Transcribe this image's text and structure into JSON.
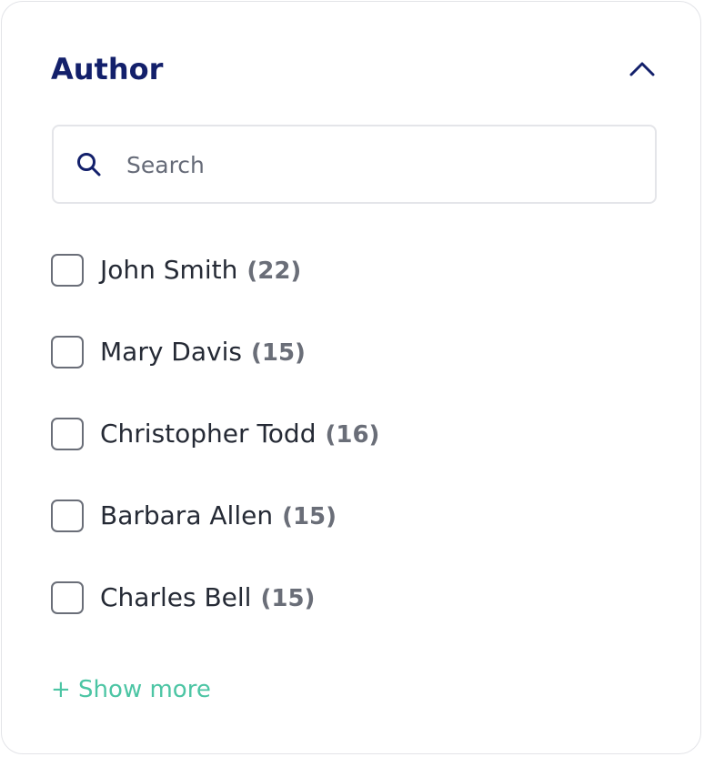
{
  "filter": {
    "title": "Author",
    "toggle_icon": "chevron-up-icon",
    "accent_color": "#13206b"
  },
  "search": {
    "placeholder": "Search",
    "value": "",
    "icon": "search-icon"
  },
  "options": [
    {
      "label": "John Smith",
      "count": "(22)",
      "checked": false
    },
    {
      "label": "Mary Davis",
      "count": "(15)",
      "checked": false
    },
    {
      "label": "Christopher Todd",
      "count": "(16)",
      "checked": false
    },
    {
      "label": "Barbara Allen",
      "count": "(15)",
      "checked": false
    },
    {
      "label": "Charles Bell",
      "count": "(15)",
      "checked": false
    }
  ],
  "show_more": {
    "label": "+ Show more",
    "color": "#4cc5a4"
  }
}
